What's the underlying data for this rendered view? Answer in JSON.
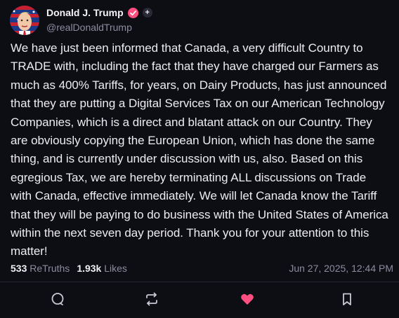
{
  "author": {
    "display_name": "Donald J. Trump",
    "handle": "@realDonaldTrump",
    "avatar_icon": "avatar-portrait-icon",
    "verified_color": "#ff4f80"
  },
  "post": {
    "text": "We have just been informed that Canada, a very difficult Country to TRADE with, including the fact that they have charged our Farmers as much as 400% Tariffs, for years, on Dairy Products, has just announced that they are putting a Digital Services Tax on our American Technology Companies, which is a direct and blatant attack on our Country. They are obviously copying the European Union, which has done the same thing, and is currently under discussion with us, also. Based on this egregious Tax, we are hereby terminating ALL discussions on Trade with Canada, effective immediately. We will let Canada know the Tariff that they will be paying to do business with the United States of America within the next seven day period. Thank you for your attention to this matter!"
  },
  "stats": {
    "retruths_count": "533",
    "retruths_label": "ReTruths",
    "likes_count": "1.93k",
    "likes_label": "Likes",
    "timestamp": "Jun 27, 2025, 12:44 PM"
  },
  "actions": [
    {
      "icon": "reply-icon"
    },
    {
      "icon": "retruth-icon"
    },
    {
      "icon": "like-heart-icon",
      "color": "#ff4f80"
    },
    {
      "icon": "bookmark-icon"
    }
  ],
  "colors": {
    "background": "#0d0d14",
    "text": "#ececf1",
    "muted": "#8c8c9e",
    "accent": "#ff4f80"
  }
}
